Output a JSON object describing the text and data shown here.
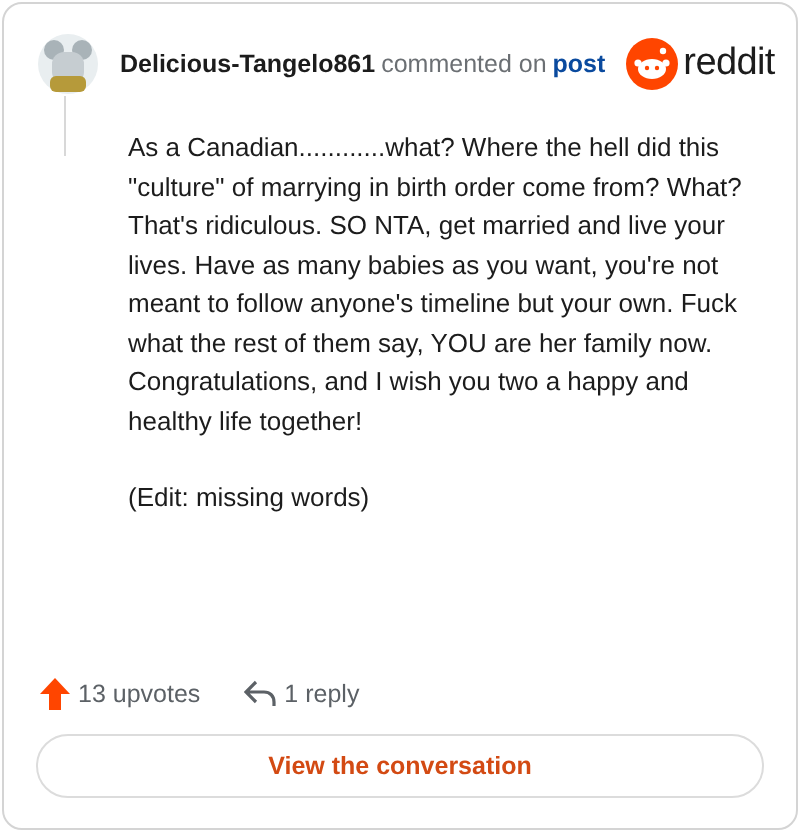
{
  "comment": {
    "author": "Delicious-Tangelo861",
    "action": "commented on",
    "target": "post",
    "brand": "reddit",
    "paragraphs": [
      "As a Canadian............what? Where the hell did this \"culture\" of marrying in birth order come from? What? That's ridiculous. SO NTA, get married and live your lives. Have as many babies as you want, you're not meant to follow anyone's timeline but your own. Fuck what the rest of them say, YOU are her family now. Congratulations, and I wish you two a happy and healthy life together!",
      "(Edit: missing words)"
    ]
  },
  "footer": {
    "upvotes": "13 upvotes",
    "replies": "1 reply"
  },
  "button": "View the conversation"
}
